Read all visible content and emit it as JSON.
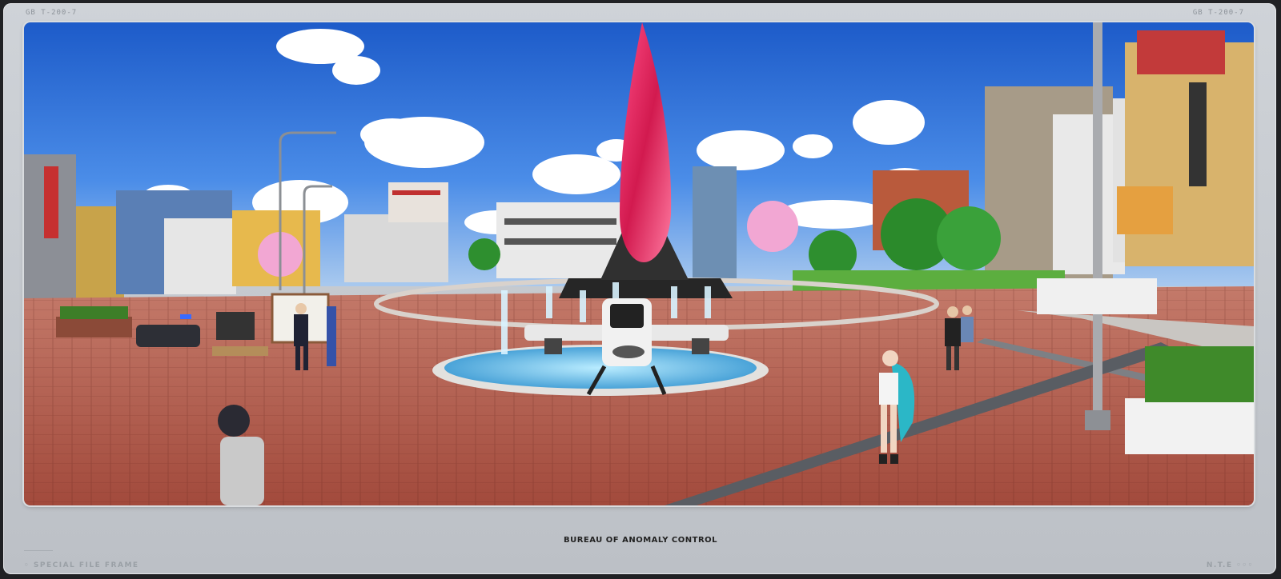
{
  "frame": {
    "corner_left": "GB  T-200-7",
    "corner_right": "GB  T-200-7",
    "caption": "BUREAU OF ANOMALY CONTROL",
    "footer_left": "◦ SPECIAL FILE FRAME",
    "footer_right": "N.T.E ◦◦◦"
  },
  "scene": {
    "description_icons": [
      "obelisk",
      "drone",
      "fountain",
      "trees",
      "buildings"
    ],
    "sky_color": "#2e6fd6",
    "plaza_color": "#b5584a",
    "obelisk_color": "#e8336a"
  }
}
